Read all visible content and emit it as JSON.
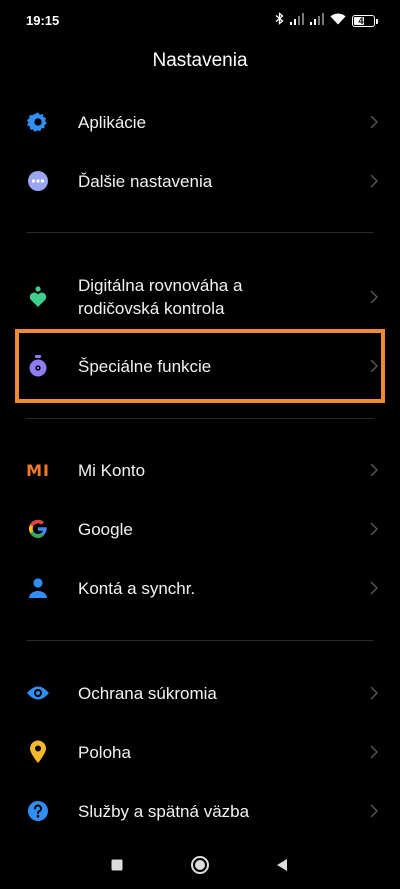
{
  "status_bar": {
    "time": "19:15",
    "battery_level": "48",
    "icons": [
      "bluetooth-icon",
      "signal-icon",
      "signal-icon",
      "wifi-icon",
      "battery-icon"
    ]
  },
  "header": {
    "title": "Nastavenia"
  },
  "colors": {
    "highlight": "#f08a32",
    "apps_icon": "#2f8ff5",
    "more_settings_icon": "#9aa6f2",
    "wellbeing_icon": "#3ecf8e",
    "accessibility_icon": "#8f7cf0",
    "mi_account_icon": "#f07a2a",
    "accounts_icon": "#2f8ff5",
    "privacy_icon": "#2f8ff5",
    "location_icon": "#f5b82c",
    "feedback_icon": "#2f8ff5"
  },
  "settings": {
    "apps": {
      "label": "Aplikácie",
      "icon": "gear-icon"
    },
    "more_settings": {
      "label": "Ďalšie nastavenia",
      "icon": "more-dots-icon"
    },
    "wellbeing": {
      "label_line1": "Digitálna rovnováha a",
      "label_line2": "rodičovská kontrola",
      "icon": "wellbeing-icon"
    },
    "accessibility": {
      "label": "Špeciálne funkcie",
      "icon": "accessibility-icon"
    },
    "mi_account": {
      "label": "Mi Konto",
      "icon": "mi-logo-icon",
      "logo_text": "MI"
    },
    "google": {
      "label": "Google",
      "icon": "google-logo-icon",
      "logo_text": "G"
    },
    "accounts": {
      "label": "Kontá a synchr.",
      "icon": "person-icon"
    },
    "privacy": {
      "label": "Ochrana súkromia",
      "icon": "eye-icon"
    },
    "location": {
      "label": "Poloha",
      "icon": "location-pin-icon"
    },
    "feedback": {
      "label": "Služby a spätná väzba",
      "icon": "help-icon"
    }
  },
  "nav_bar": {
    "buttons": [
      "recents-button",
      "home-button",
      "back-button"
    ]
  }
}
